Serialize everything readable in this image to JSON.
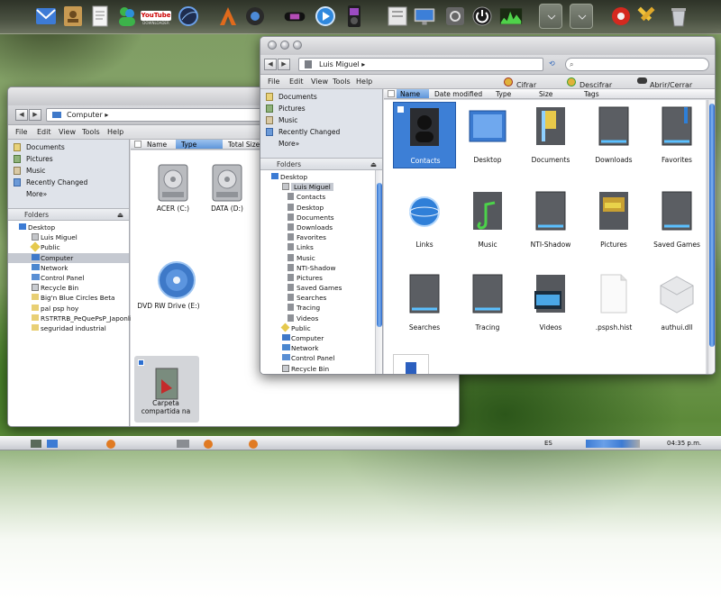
{
  "dock": {
    "icons": [
      "mail-icon",
      "contacts-icon",
      "document-icon",
      "messenger-icon",
      "youtube-icon",
      "world-icon",
      "app-store-icon",
      "camera-icon",
      "psp-icon",
      "media-player-icon",
      "ipod-icon",
      "system-icon",
      "monitor-icon",
      "settings-icon",
      "power-icon",
      "activity-icon",
      "blank-window-icon",
      "blank-window-icon-2",
      "chrome-icon",
      "tools-icon",
      "trash-icon"
    ],
    "youtube_label": "YouTube",
    "youtube_sub": "DOWNLOADER"
  },
  "win_front": {
    "address": "Luis Miguel",
    "menu": [
      "File",
      "Edit",
      "View",
      "Tools",
      "Help"
    ],
    "commands": [
      "Cifrar archivo",
      "Descifrar archivo",
      "Abrir/Cerrar PSD"
    ],
    "favorites": [
      "Documents",
      "Pictures",
      "Music",
      "Recently Changed",
      "More»"
    ],
    "folders_label": "Folders",
    "tree": [
      "Desktop",
      "Luis Miguel",
      "Contacts",
      "Desktop",
      "Documents",
      "Downloads",
      "Favorites",
      "Links",
      "Music",
      "NTI-Shadow",
      "Pictures",
      "Saved Games",
      "Searches",
      "Tracing",
      "Videos",
      "Public",
      "Computer",
      "Network",
      "Control Panel",
      "Recycle Bin"
    ],
    "columns": [
      "Name",
      "Date modified",
      "Type",
      "Size",
      "Tags"
    ],
    "items": [
      "Contacts",
      "Desktop",
      "Documents",
      "Downloads",
      "Favorites",
      "Links",
      "Music",
      "NTI-Shadow",
      "Pictures",
      "Saved Games",
      "Searches",
      "Tracing",
      "Videos",
      ".pspsh.hist",
      "authui.dll"
    ]
  },
  "win_back": {
    "address": "Computer",
    "menu": [
      "File",
      "Edit",
      "View",
      "Tools",
      "Help"
    ],
    "favorites": [
      "Documents",
      "Pictures",
      "Music",
      "Recently Changed",
      "More»"
    ],
    "folders_label": "Folders",
    "tree": [
      "Desktop",
      "Luis Miguel",
      "Public",
      "Computer",
      "Network",
      "Control Panel",
      "Recycle Bin",
      "Big'n Blue Circles Beta",
      "pal psp hoy",
      "RSTRTRB_PeQuePsP_Japonline",
      "seguridad industrial"
    ],
    "columns": [
      "Name",
      "Type",
      "Total Size"
    ],
    "items": [
      "ACER (C:)",
      "DATA (D:)",
      "DVD RW Drive (E:)",
      "Carpeta compartida na"
    ]
  },
  "taskbar": {
    "language": "ES",
    "clock": "04:35 p.m."
  }
}
